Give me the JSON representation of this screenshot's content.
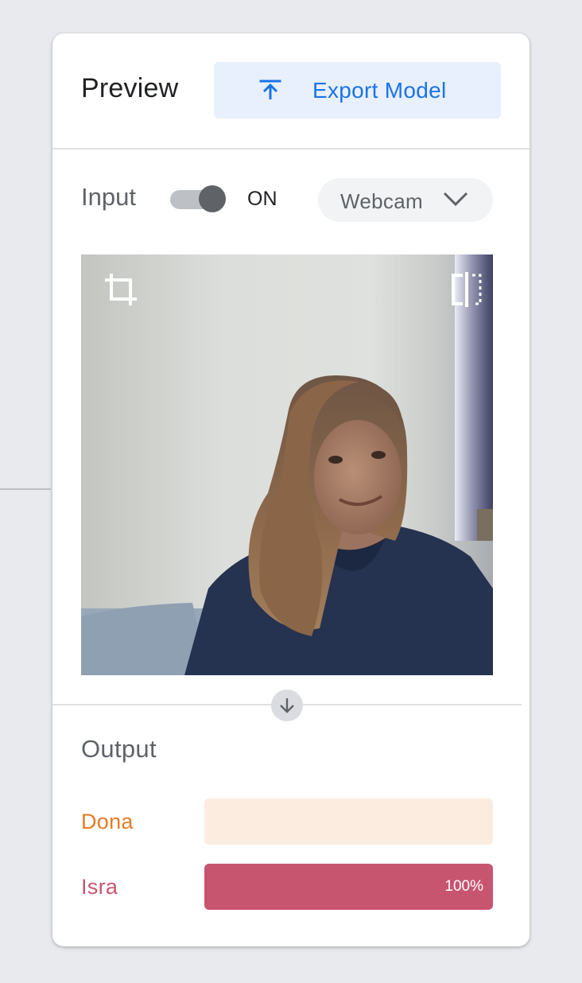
{
  "header": {
    "title": "Preview",
    "export_label": "Export Model"
  },
  "input": {
    "label": "Input",
    "toggle_on": true,
    "toggle_state": "ON",
    "source": "Webcam"
  },
  "webcam": {
    "crop_icon": "crop-icon",
    "flip_icon": "flip-icon"
  },
  "output": {
    "title": "Output",
    "classes": [
      {
        "name": "Dona",
        "color": "#e67c24",
        "bar_color": "#fcece0",
        "confidence": 0,
        "pct_label": ""
      },
      {
        "name": "Isra",
        "color": "#c8556f",
        "bar_color": "#fde8ec",
        "confidence": 1.0,
        "pct_label": "100%"
      }
    ]
  },
  "colors": {
    "accent": "#1a73e8",
    "accent_bg": "#e8f0fe"
  }
}
